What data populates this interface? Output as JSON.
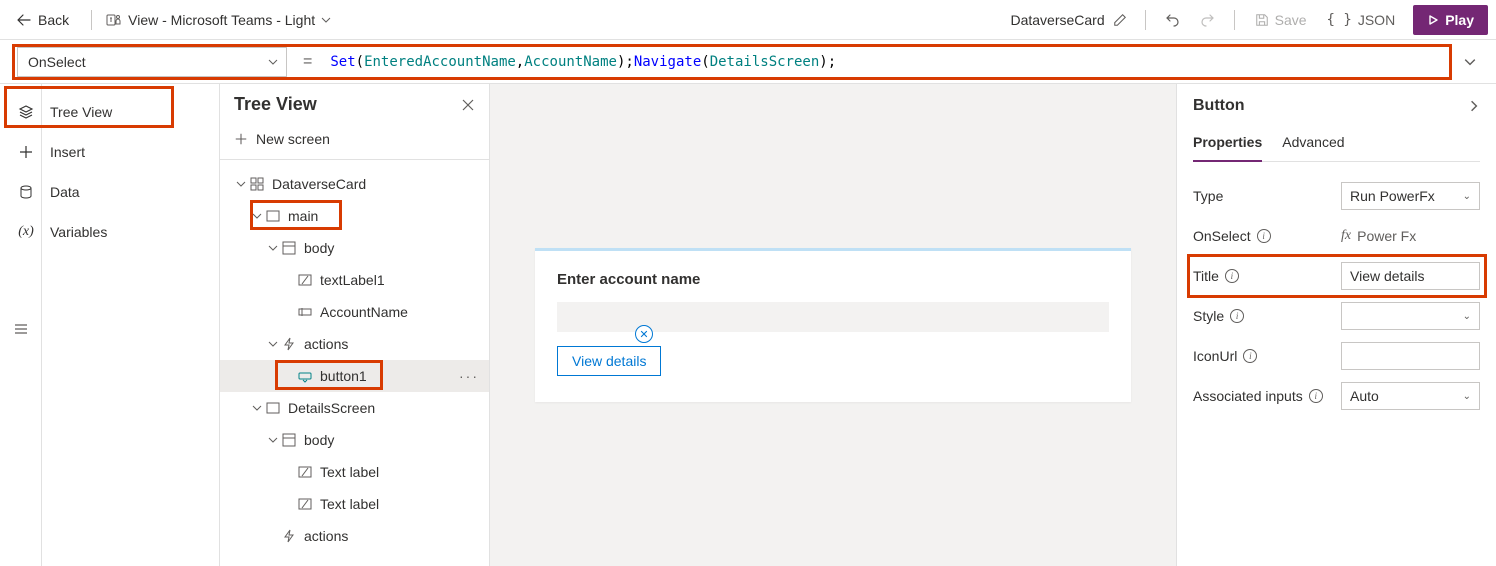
{
  "top": {
    "back": "Back",
    "theme": "View - Microsoft Teams - Light",
    "card_name": "DataverseCard",
    "save": "Save",
    "json": "JSON",
    "play": "Play"
  },
  "fx": {
    "property": "OnSelect",
    "tok_set": "Set",
    "tok_lp1": "(",
    "tok_ent": "EnteredAccountName",
    "tok_comma": ", ",
    "tok_acc": "AccountName",
    "tok_rp1": "); ",
    "tok_nav": "Navigate",
    "tok_lp2": "(",
    "tok_det": "DetailsScreen",
    "tok_rp2": ");"
  },
  "nav": {
    "tree": "Tree View",
    "insert": "Insert",
    "data": "Data",
    "vars": "Variables"
  },
  "tree": {
    "title": "Tree View",
    "new_screen": "New screen",
    "items": {
      "root": "DataverseCard",
      "main": "main",
      "body1": "body",
      "tl1": "textLabel1",
      "acc": "AccountName",
      "actions1": "actions",
      "btn1": "button1",
      "det": "DetailsScreen",
      "body2": "body",
      "txtlabA": "Text label",
      "txtlabB": "Text label",
      "actions2": "actions"
    }
  },
  "canvas": {
    "label": "Enter account name",
    "button": "View details"
  },
  "props": {
    "panel_title": "Button",
    "tab_props": "Properties",
    "tab_adv": "Advanced",
    "rows": {
      "type_label": "Type",
      "type_value": "Run PowerFx",
      "onselect_label": "OnSelect",
      "onselect_value": "Power Fx",
      "title_label": "Title",
      "title_value": "View details",
      "style_label": "Style",
      "iconurl_label": "IconUrl",
      "assoc_label": "Associated inputs",
      "assoc_value": "Auto"
    }
  }
}
